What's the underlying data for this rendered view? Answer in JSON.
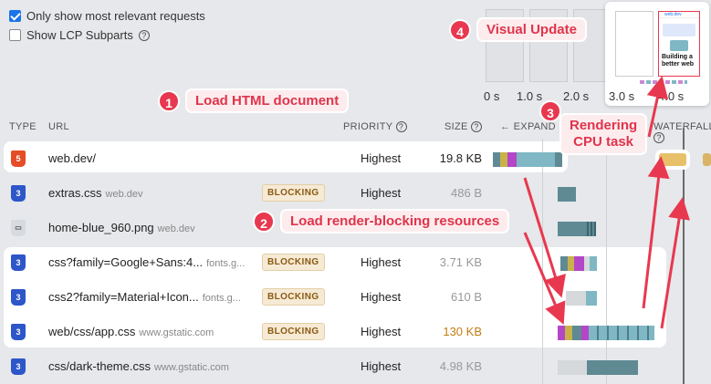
{
  "options": [
    {
      "label": "Only show most relevant requests",
      "checked": true
    },
    {
      "label": "Show LCP Subparts",
      "checked": false
    }
  ],
  "filmstrip": {
    "ticks": [
      "0 s",
      "1.0 s",
      "2.0 s",
      "3.0 s",
      "4.0 s"
    ],
    "thumb_heading": "Building a better web",
    "thumb_logo": "web.dev"
  },
  "columns": {
    "type": "TYPE",
    "url": "URL",
    "priority": "PRIORITY",
    "size": "SIZE",
    "expand": "EXPAND",
    "waterfall": "WATERFALL"
  },
  "rows": [
    {
      "type": "html",
      "url": "web.dev/",
      "host": "",
      "blocking": "",
      "priority": "Highest",
      "size": "19.8 KB"
    },
    {
      "type": "css",
      "url": "extras.css",
      "host": "web.dev",
      "blocking": "BLOCKING",
      "priority": "Highest",
      "size": "486 B"
    },
    {
      "type": "image",
      "url": "home-blue_960.png",
      "host": "web.dev",
      "blocking": "",
      "priority": "",
      "size": ""
    },
    {
      "type": "css",
      "url": "css?family=Google+Sans:4...",
      "host": "fonts.g...",
      "blocking": "BLOCKING",
      "priority": "Highest",
      "size": "3.71 KB"
    },
    {
      "type": "css",
      "url": "css2?family=Material+Icon...",
      "host": "fonts.g...",
      "blocking": "BLOCKING",
      "priority": "Highest",
      "size": "610 B"
    },
    {
      "type": "css",
      "url": "web/css/app.css",
      "host": "www.gstatic.com",
      "blocking": "BLOCKING",
      "priority": "Highest",
      "size": "130 KB"
    },
    {
      "type": "css",
      "url": "css/dark-theme.css",
      "host": "www.gstatic.com",
      "blocking": "",
      "priority": "Highest",
      "size": "4.98 KB"
    }
  ],
  "callouts": [
    {
      "n": "1",
      "text": "Load HTML document"
    },
    {
      "n": "2",
      "text": "Load render-blocking resources"
    },
    {
      "n": "3",
      "text": "Rendering\nCPU task"
    },
    {
      "n": "4",
      "text": "Visual Update"
    }
  ],
  "colors": {
    "accent": "#e8384f",
    "html_icon": "#e44d26",
    "css_icon": "#2d56c9",
    "bar_teal": "#5f8a94",
    "bar_lightteal": "#7fb7c4",
    "cpu_task": "#e8c06a"
  },
  "icons": {
    "help": "question-circle-icon",
    "expand": "arrow-left-icon"
  }
}
